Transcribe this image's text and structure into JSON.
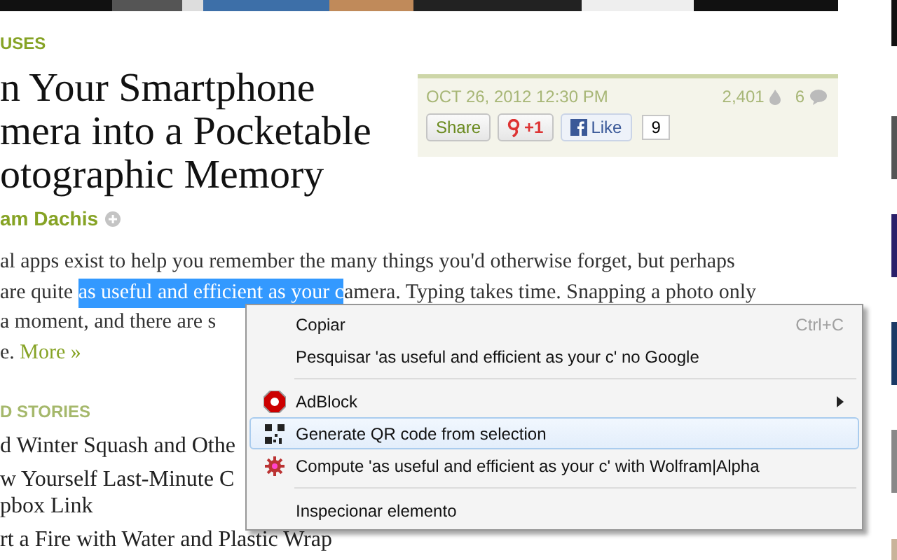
{
  "article": {
    "category": "USES",
    "headline": [
      "n Your Smartphone",
      "mera into a Pocketable",
      "otographic Memory"
    ],
    "author": "am Dachis",
    "body": [
      [
        {
          "kind": "plain",
          "text": "al apps exist to help you remember the many things you'd otherwise forget, but perhaps"
        }
      ],
      [
        {
          "kind": "plain",
          "text": "are quite "
        },
        {
          "kind": "selected",
          "text": "as useful and efficient as your c"
        },
        {
          "kind": "plain",
          "text": "amera. Typing takes time. Snapping a photo only"
        }
      ],
      [
        {
          "kind": "plain",
          "text": "a moment, and there are s"
        }
      ],
      [
        {
          "kind": "plain",
          "text": "e. "
        },
        {
          "kind": "link",
          "text": "More »"
        }
      ]
    ]
  },
  "info_box": {
    "date": "OCT 26, 2012 12:30 PM",
    "views": "2,401",
    "comments": "6",
    "share": "Share",
    "plus_one": "+1",
    "like": "Like",
    "like_count": "9"
  },
  "stories": {
    "title": "D STORIES",
    "items": [
      [
        "d Winter Squash and Othe"
      ],
      [
        "w Yourself Last-Minute C",
        "pbox Link"
      ],
      [
        "rt a Fire with Water and Plastic Wrap"
      ]
    ]
  },
  "context_menu": [
    {
      "kind": "item",
      "label": "Copiar",
      "shortcut": "Ctrl+C",
      "selected": false
    },
    {
      "kind": "item",
      "label": "Pesquisar 'as useful and efficient as your c' no Google",
      "selected": false
    },
    {
      "kind": "separator"
    },
    {
      "kind": "item",
      "label": "AdBlock",
      "submenu": true,
      "selected": false
    },
    {
      "kind": "item",
      "label": "Generate QR code from selection",
      "selected": true
    },
    {
      "kind": "item",
      "label": "Compute 'as useful and efficient as your c' with Wolfram|Alpha",
      "selected": false
    },
    {
      "kind": "separator"
    },
    {
      "kind": "item",
      "label": "Inspecionar elemento",
      "selected": false
    }
  ]
}
